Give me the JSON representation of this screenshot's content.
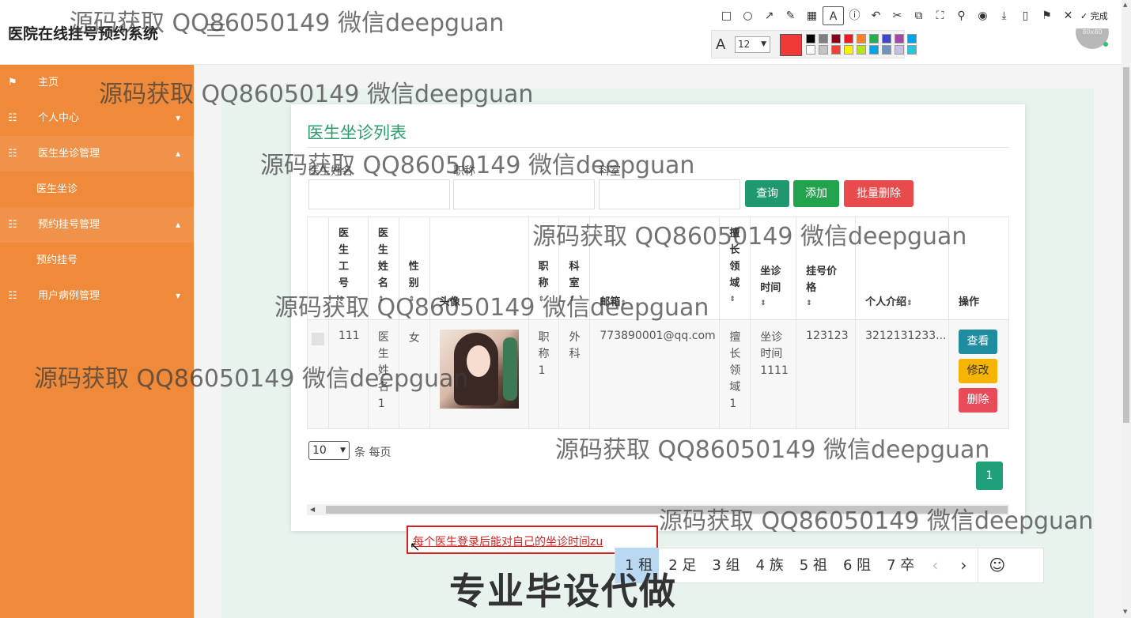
{
  "header": {
    "app_title": "医院在线挂号预约系统",
    "avatar_text": "80x80"
  },
  "screenshot_tool": {
    "done_label": "完成",
    "font_size": "12",
    "current_color": "#f03a3a",
    "swatches": [
      "#000000",
      "#7f7f7f",
      "#880015",
      "#ed1c24",
      "#ff7f27",
      "#22b14c",
      "#3f48cc",
      "#a349a4",
      "#00a2e8",
      "#ffffff",
      "#c3c3c3",
      "#ef4136",
      "#fff200",
      "#b5e61d",
      "#00a2e8",
      "#7092be",
      "#c8bfe7",
      "#29c7d8"
    ]
  },
  "sidebar": {
    "items": [
      {
        "label": "主页",
        "icon": "flag-icon"
      },
      {
        "label": "个人中心",
        "icon": "grid-icon"
      },
      {
        "label": "医生坐诊管理",
        "icon": "grid-icon"
      },
      {
        "label": "医生坐诊"
      },
      {
        "label": "预约挂号管理",
        "icon": "grid-icon"
      },
      {
        "label": "预约挂号"
      },
      {
        "label": "用户病例管理",
        "icon": "grid-icon"
      }
    ]
  },
  "main": {
    "title": "医生坐诊列表",
    "search": {
      "name_label": "医生姓名",
      "title_label": "职称",
      "dept_label": "科室"
    },
    "buttons": {
      "query": "查询",
      "add": "添加",
      "batch_delete": "批量删除"
    },
    "table": {
      "headers": [
        "医生工号",
        "医生姓名",
        "性别",
        "头像",
        "职称",
        "科室",
        "邮箱",
        "擅长领域",
        "坐诊时间",
        "挂号价格",
        "个人介绍",
        "操作"
      ],
      "rows": [
        {
          "doctor_id": "111",
          "name": "医生姓名1",
          "gender": "女",
          "title": "职称1",
          "dept": "外科",
          "email": "773890001@qq.com",
          "specialty": "擅长领域1",
          "time": "坐诊时间1111",
          "price": "123123",
          "intro": "3212131233..."
        }
      ],
      "ops": {
        "view": "查看",
        "edit": "修改",
        "delete": "删除"
      }
    },
    "pagination": {
      "per_page": "10",
      "per_page_label": "条 每页",
      "current_page": "1"
    }
  },
  "note": {
    "text": "每个医生登录后能对自己的坐诊时间zu"
  },
  "ime": {
    "candidates": [
      "1 租",
      "2 足",
      "3 组",
      "4 族",
      "5 祖",
      "6 阻",
      "7 卒"
    ],
    "prev": "‹",
    "next": "›",
    "emoji": "☺"
  },
  "watermarks": {
    "text": "源码获取 QQ86050149 微信deepguan",
    "promo": "专业毕设代做"
  }
}
